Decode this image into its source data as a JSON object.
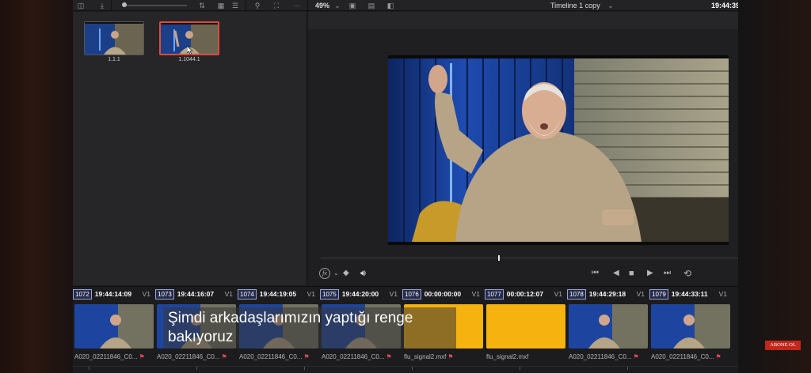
{
  "toolbar": {
    "zoom_percent": "49%",
    "timeline_name": "Timeline 1 copy",
    "timecode": "19:44:39"
  },
  "media_pool": {
    "clips": [
      {
        "label": "1.1.1",
        "selected": false
      },
      {
        "label": "1.1044.1",
        "selected": true
      }
    ]
  },
  "viewer": {
    "icons": [
      "effects-icon",
      "mask-icon",
      "volume-icon",
      "skip-back-icon",
      "step-back-icon",
      "stop-icon",
      "play-icon",
      "skip-forward-icon",
      "loop-icon"
    ]
  },
  "timeline": {
    "clips": [
      {
        "num": "1072",
        "tc": "19:44:14:09",
        "track": "V1",
        "name": "A020_02211846_C0...",
        "type": "video"
      },
      {
        "num": "1073",
        "tc": "19:44:16:07",
        "track": "V1",
        "name": "A020_02211846_C0...",
        "type": "video"
      },
      {
        "num": "1074",
        "tc": "19:44:19:05",
        "track": "V1",
        "name": "A020_02211846_C0...",
        "type": "video"
      },
      {
        "num": "1075",
        "tc": "19:44:20:00",
        "track": "V1",
        "name": "A020_02211846_C0...",
        "type": "video"
      },
      {
        "num": "1076",
        "tc": "00:00:00:00",
        "track": "V1",
        "name": "flu_signal2.mxf",
        "type": "flat"
      },
      {
        "num": "1077",
        "tc": "00:00:12:07",
        "track": "V1",
        "name": "flu_signal2.mxf",
        "type": "flat"
      },
      {
        "num": "1078",
        "tc": "19:44:29:18",
        "track": "V1",
        "name": "A020_02211846_C0...",
        "type": "video"
      },
      {
        "num": "1079",
        "tc": "19:44:33:11",
        "track": "V1",
        "name": "A020_02211846_C0...",
        "type": "video"
      }
    ]
  },
  "subtitle": {
    "line1": "Şimdi arkadaşlarımızın yaptığı renge",
    "line2": "bakıyoruz"
  },
  "badge": {
    "label": "ABONE OL"
  },
  "colors": {
    "flat_clip": "#f6b20e",
    "selection": "#e04a3c",
    "app_bg": "#1c1c1e"
  }
}
